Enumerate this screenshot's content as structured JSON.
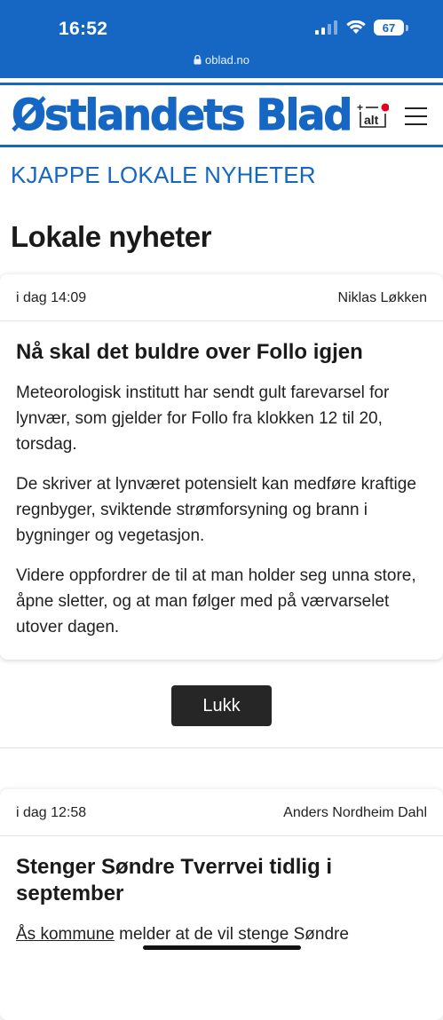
{
  "status_bar": {
    "time": "16:52",
    "battery": "67",
    "url": "oblad.no"
  },
  "header": {
    "logo": "Østlandets Blad",
    "alt_icon_label": "alt"
  },
  "section_title": "KJAPPE LOKALE NYHETER",
  "page_title": "Lokale nyheter",
  "articles": [
    {
      "date": "i dag 14:09",
      "author": "Niklas Løkken",
      "headline": "Nå skal det buldre over Follo igjen",
      "paragraphs": [
        "Meteorologisk institutt har sendt gult farevarsel for lynvær, som gjelder for Follo fra klokken 12 til 20, torsdag.",
        "De skriver at lynværet potensielt kan medføre kraftige regnbyger, sviktende strømforsyning og brann i bygninger og vegetasjon.",
        "Videre oppfordrer de til at man holder seg unna store, åpne sletter, og at man følger med på værvarselet utover dagen."
      ]
    },
    {
      "date": "i dag 12:58",
      "author": "Anders Nordheim Dahl",
      "headline": "Stenger Søndre Tverrvei tidlig i september",
      "paragraph_link": "Ås kommune",
      "paragraph_rest": " melder at de vil stenge Søndre"
    }
  ],
  "close_button": "Lukk",
  "colors": {
    "brand": "#1667c4",
    "button": "#262626",
    "alert_dot": "#e3001b"
  }
}
